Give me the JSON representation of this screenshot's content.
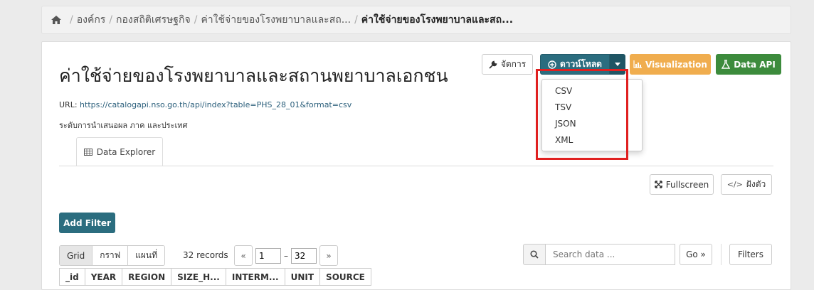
{
  "breadcrumb": {
    "items": [
      "องค์กร",
      "กองสถิติเศรษฐกิจ",
      "ค่าใช้จ่ายของโรงพยาบาลและสถ..."
    ],
    "active": "ค่าใช้จ่ายของโรงพยาบาลและสถ..."
  },
  "resource": {
    "title": "ค่าใช้จ่ายของโรงพยาบาลและสถานพยาบาลเอกชน",
    "url_label": "URL:",
    "url": "https://catalogapi.nso.go.th/api/index?table=PHS_28_01&format=csv",
    "level": "ระดับการนำเสนอผล ภาค และประเทศ"
  },
  "actions": {
    "manage": "จัดการ",
    "download": "ดาวน์โหลด",
    "visualization": "Visualization",
    "data_api": "Data API"
  },
  "download_menu": [
    "CSV",
    "TSV",
    "JSON",
    "XML"
  ],
  "tabs": {
    "data_explorer": "Data Explorer"
  },
  "explorer": {
    "fullscreen": "Fullscreen",
    "embed": "ฝังตัว",
    "add_filter": "Add Filter",
    "views": [
      "Grid",
      "กราฟ",
      "แผนที่"
    ],
    "records": "32 records",
    "pager_from": "1",
    "pager_to": "32",
    "pager_sep": "–",
    "search_placeholder": "Search data ...",
    "go": "Go »",
    "filters": "Filters",
    "columns": [
      "_id",
      "YEAR",
      "REGION",
      "SIZE_H...",
      "INTERM...",
      "UNIT",
      "SOURCE"
    ]
  },
  "colors": {
    "primary": "#2b6d7f",
    "warning": "#f0ad4e",
    "success": "#3c8b3c",
    "highlight": "#e02020"
  }
}
